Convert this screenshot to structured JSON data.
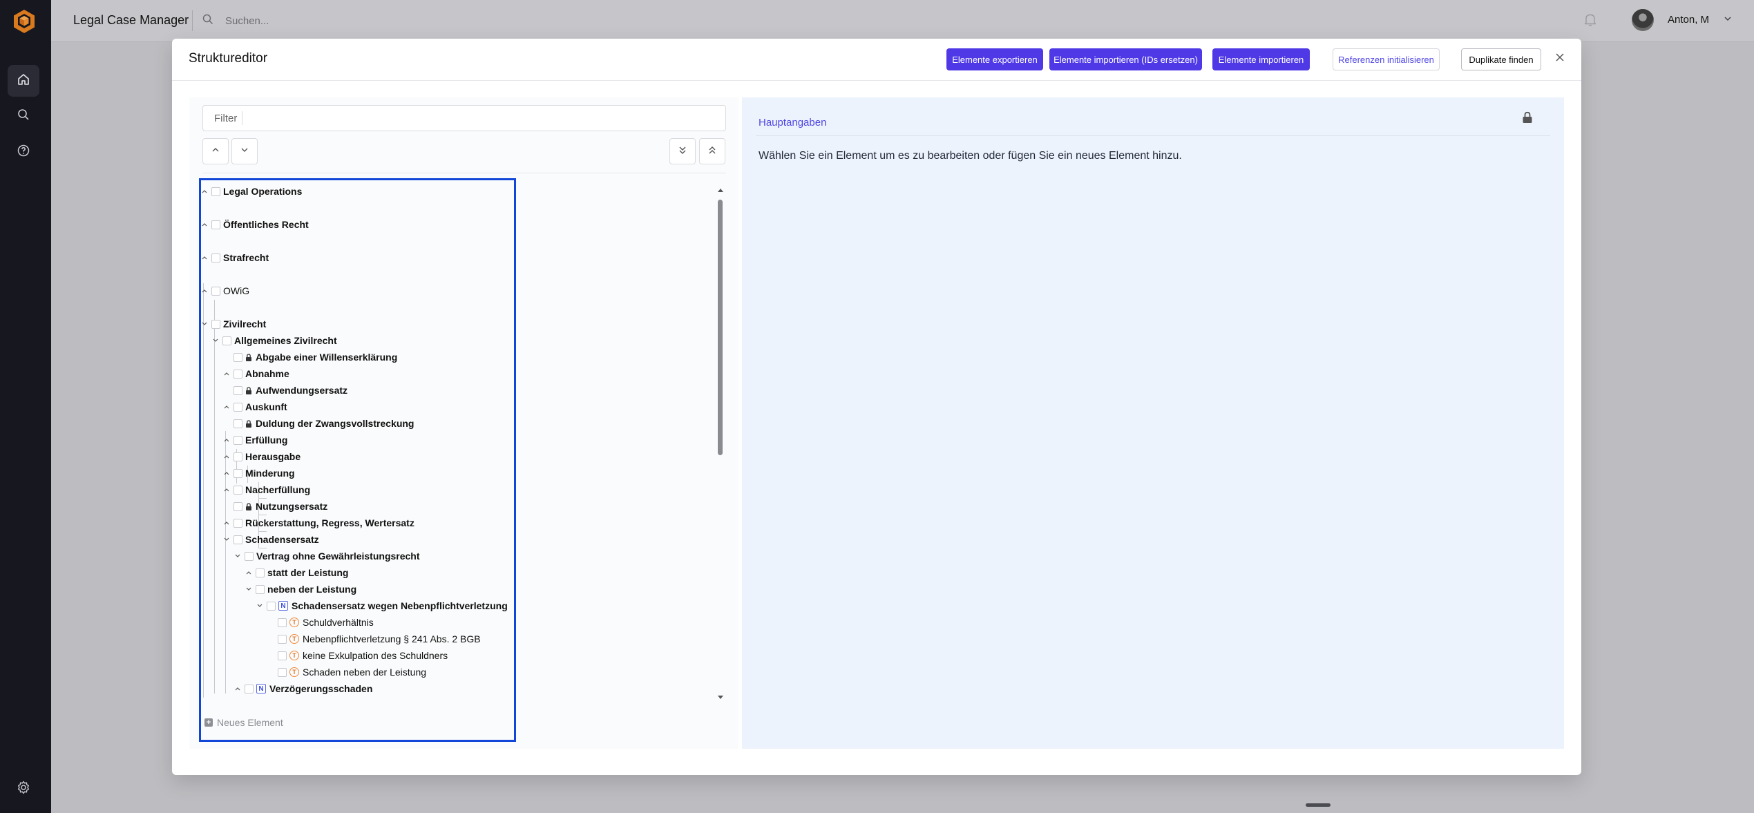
{
  "app": {
    "title": "Legal Case Manager",
    "search_placeholder": "Suchen...",
    "user_name": "Anton, M"
  },
  "sidebar": {
    "items": [
      {
        "name": "home",
        "active": true
      },
      {
        "name": "search",
        "active": false
      },
      {
        "name": "help",
        "active": false
      }
    ],
    "bottom": "settings"
  },
  "modal": {
    "title": "Struktureditor",
    "buttons": {
      "export": "Elemente exportieren",
      "import_replace": "Elemente importieren (IDs ersetzen)",
      "import": "Elemente importieren",
      "init_refs": "Referenzen initialisieren",
      "find_duplicates": "Duplikate finden"
    },
    "filter_placeholder": "Filter",
    "new_element": "Neues Element",
    "tree": [
      {
        "label": "Legal Operations",
        "bold": true,
        "expanded": false
      },
      {
        "label": "Öffentliches Recht",
        "bold": true,
        "expanded": false
      },
      {
        "label": "Strafrecht",
        "bold": true,
        "expanded": false
      },
      {
        "label": "OWiG",
        "bold": false,
        "expanded": false
      },
      {
        "label": "Zivilrecht",
        "bold": true,
        "expanded": true
      },
      {
        "label": "Allgemeines Zivilrecht",
        "bold": true,
        "expanded": true
      },
      {
        "label": "Abgabe einer Willenserklärung",
        "bold": true,
        "locked": true
      },
      {
        "label": "Abnahme",
        "bold": true,
        "expanded": false
      },
      {
        "label": "Aufwendungsersatz",
        "bold": true,
        "locked": true
      },
      {
        "label": "Auskunft",
        "bold": true,
        "expanded": false
      },
      {
        "label": "Duldung der Zwangsvollstreckung",
        "bold": true,
        "locked": true
      },
      {
        "label": "Erfüllung",
        "bold": true,
        "expanded": false
      },
      {
        "label": "Herausgabe",
        "bold": true,
        "expanded": false
      },
      {
        "label": "Minderung",
        "bold": true,
        "expanded": false
      },
      {
        "label": "Nacherfüllung",
        "bold": true,
        "expanded": false
      },
      {
        "label": "Nutzungsersatz",
        "bold": true,
        "locked": true
      },
      {
        "label": "Rückerstattung, Regress, Wertersatz",
        "bold": true,
        "expanded": false
      },
      {
        "label": "Schadensersatz",
        "bold": true,
        "expanded": true
      },
      {
        "label": "Vertrag ohne Gewährleistungsrecht",
        "bold": true,
        "expanded": true
      },
      {
        "label": "statt der Leistung",
        "bold": true,
        "expanded": false
      },
      {
        "label": "neben der Leistung",
        "bold": true,
        "expanded": true
      },
      {
        "label": "Schadensersatz wegen Nebenpflichtverletzung",
        "bold": true,
        "expanded": true,
        "badge": "N"
      },
      {
        "label": "Schuldverhältnis",
        "bold": false,
        "badge": "T"
      },
      {
        "label": "Nebenpflichtverletzung § 241 Abs. 2 BGB",
        "bold": false,
        "badge": "T"
      },
      {
        "label": "keine Exkulpation des Schuldners",
        "bold": false,
        "badge": "T"
      },
      {
        "label": "Schaden neben der Leistung",
        "bold": false,
        "badge": "T"
      },
      {
        "label": "Verzögerungsschaden",
        "bold": true,
        "expanded": false,
        "badge": "N"
      }
    ],
    "detail": {
      "title": "Hauptangaben",
      "message": "Wählen Sie ein Element um es zu bearbeiten oder fügen Sie ein neues Element hinzu."
    }
  },
  "colors": {
    "primary": "#4f39e6",
    "selection": "#1146d8",
    "sidebar": "#17171f",
    "detail_bg": "#edf3fd"
  }
}
